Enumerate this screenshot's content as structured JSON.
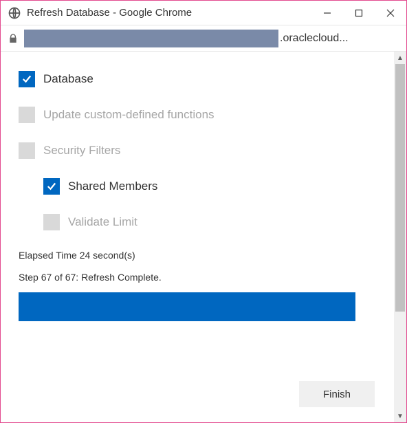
{
  "window": {
    "title": "Refresh Database - Google Chrome"
  },
  "address": {
    "url_suffix": ".oraclecloud..."
  },
  "options": {
    "database": {
      "label": "Database",
      "checked": true,
      "enabled": true
    },
    "update_custom": {
      "label": "Update custom-defined functions",
      "checked": false,
      "enabled": false
    },
    "security_filters": {
      "label": "Security Filters",
      "checked": false,
      "enabled": false
    },
    "shared_members": {
      "label": "Shared Members",
      "checked": true,
      "enabled": true
    },
    "validate_limit": {
      "label": "Validate Limit",
      "checked": false,
      "enabled": false
    }
  },
  "status": {
    "elapsed": "Elapsed Time 24 second(s)",
    "step": "Step 67 of 67: Refresh Complete."
  },
  "buttons": {
    "finish": "Finish"
  }
}
